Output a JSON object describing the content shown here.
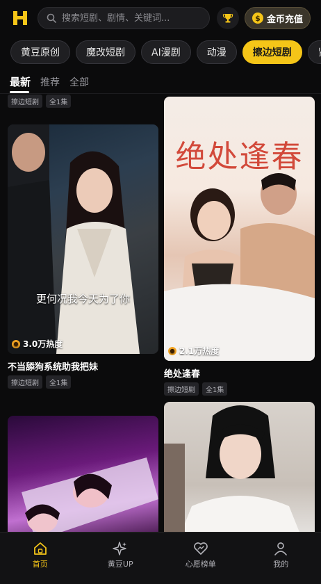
{
  "header": {
    "search_placeholder": "搜索短剧、剧情、关键词...",
    "recharge_label": "金币充值",
    "coin_symbol": "$",
    "accent_color": "#f5c518"
  },
  "categories": [
    {
      "label": "黄豆原创",
      "active": false
    },
    {
      "label": "魔改短剧",
      "active": false
    },
    {
      "label": "AI漫剧",
      "active": false
    },
    {
      "label": "动漫",
      "active": false
    },
    {
      "label": "擦边短剧",
      "active": true
    },
    {
      "label": "贤",
      "active": false
    }
  ],
  "subtabs": [
    {
      "label": "最新",
      "active": true
    },
    {
      "label": "推荐",
      "active": false
    },
    {
      "label": "全部",
      "active": false
    }
  ],
  "cards": [
    {
      "title": "",
      "heat": "",
      "tags": [
        "擦边短剧",
        "全1集"
      ],
      "poster_text": ""
    },
    {
      "title": "不当舔狗系统助我把妹",
      "heat": "3.0万热度",
      "tags": [
        "擦边短剧",
        "全1集"
      ],
      "poster_text": "更何况我今天为了你"
    },
    {
      "title": "",
      "heat": "",
      "tags": [],
      "poster_text": ""
    },
    {
      "title": "绝处逢春",
      "heat": "2.1万热度",
      "tags": [
        "擦边短剧",
        "全1集"
      ],
      "poster_text": "绝处逢春"
    },
    {
      "title": "",
      "heat": "",
      "tags": [],
      "poster_text": ""
    }
  ],
  "nav": [
    {
      "label": "首页",
      "icon": "home-icon",
      "active": true
    },
    {
      "label": "黄豆UP",
      "icon": "sparkle-icon",
      "active": false
    },
    {
      "label": "心愿榜单",
      "icon": "heart-icon",
      "active": false
    },
    {
      "label": "我的",
      "icon": "user-icon",
      "active": false
    }
  ]
}
